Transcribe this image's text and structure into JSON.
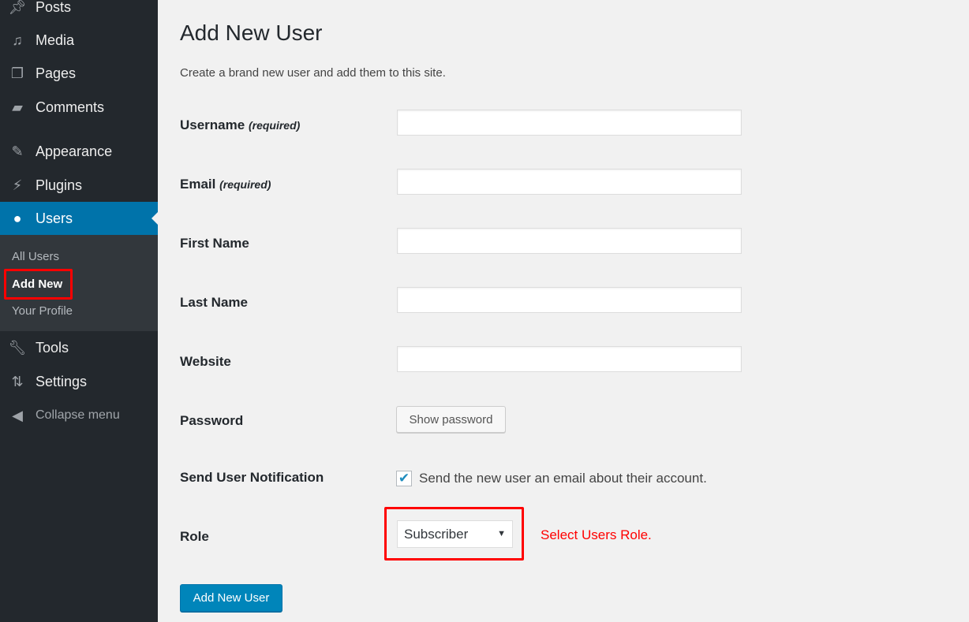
{
  "sidebar": {
    "items": [
      {
        "label": "Posts",
        "icon": "pin-icon"
      },
      {
        "label": "Media",
        "icon": "media-icon"
      },
      {
        "label": "Pages",
        "icon": "pages-icon"
      },
      {
        "label": "Comments",
        "icon": "comment-icon"
      },
      {
        "label": "Appearance",
        "icon": "paintbrush-icon"
      },
      {
        "label": "Plugins",
        "icon": "plugin-icon"
      },
      {
        "label": "Users",
        "icon": "user-icon",
        "active": true
      },
      {
        "label": "Tools",
        "icon": "wrench-icon"
      },
      {
        "label": "Settings",
        "icon": "settings-icon"
      }
    ],
    "submenu": [
      "All Users",
      "Add New",
      "Your Profile"
    ],
    "collapse": "Collapse menu"
  },
  "page": {
    "title": "Add New User",
    "description": "Create a brand new user and add them to this site.",
    "required": "(required)",
    "fields": {
      "username": {
        "label": "Username",
        "value": ""
      },
      "email": {
        "label": "Email",
        "value": ""
      },
      "first_name": {
        "label": "First Name",
        "value": ""
      },
      "last_name": {
        "label": "Last Name",
        "value": ""
      },
      "website": {
        "label": "Website",
        "value": ""
      }
    },
    "password": {
      "label": "Password",
      "button": "Show password"
    },
    "notification": {
      "label": "Send User Notification",
      "checkbox_label": "Send the new user an email about their account.",
      "checked": true
    },
    "role": {
      "label": "Role",
      "selected": "Subscriber",
      "annotation": "Select Users Role."
    },
    "submit": "Add New User"
  },
  "colors": {
    "accent": "#0073aa",
    "sidebar": "#23282d",
    "highlight": "#ff0000"
  }
}
